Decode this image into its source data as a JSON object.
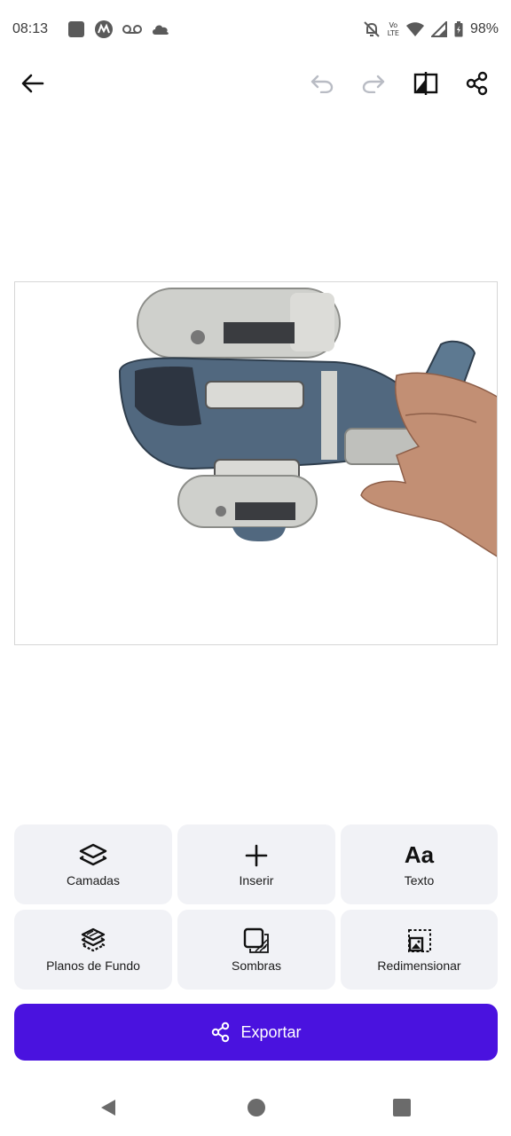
{
  "status_bar": {
    "time": "08:13",
    "lte_top": "Vo",
    "lte_bottom": "LTE",
    "battery": "98%"
  },
  "toolbar": {
    "icons": [
      "back-arrow-icon",
      "undo-icon",
      "redo-icon",
      "compare-icon",
      "share-icon"
    ]
  },
  "tools": [
    {
      "label": "Camadas",
      "icon": "layers-icon"
    },
    {
      "label": "Inserir",
      "icon": "plus-icon"
    },
    {
      "label": "Texto",
      "icon": "text-icon",
      "glyph": "Aa"
    },
    {
      "label": "Planos de Fundo",
      "icon": "background-icon"
    },
    {
      "label": "Sombras",
      "icon": "shadow-icon"
    },
    {
      "label": "Redimensionar",
      "icon": "resize-icon"
    }
  ],
  "export_button": {
    "label": "Exportar",
    "icon": "share-icon"
  },
  "colors": {
    "accent": "#4a12df",
    "tool_bg": "#f1f2f6",
    "disabled_icon": "#b9bcc4"
  }
}
